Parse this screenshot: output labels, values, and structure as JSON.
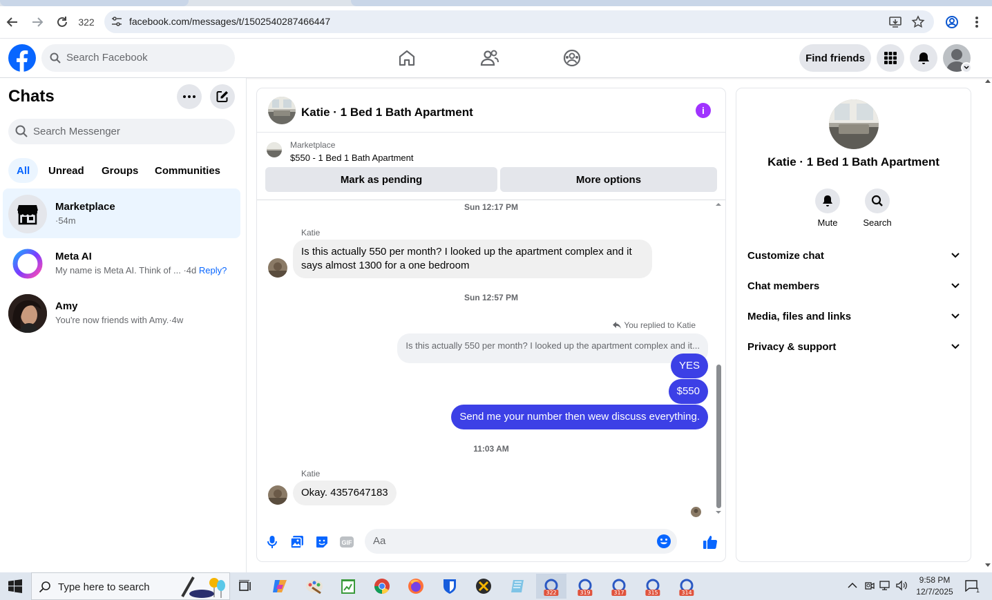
{
  "browser": {
    "tab_count": "322",
    "url": "facebook.com/messages/t/1502540287466447"
  },
  "fb_header": {
    "search_placeholder": "Search Facebook",
    "find_friends": "Find friends"
  },
  "left": {
    "title": "Chats",
    "search_placeholder": "Search Messenger",
    "filters": [
      "All",
      "Unread",
      "Groups",
      "Communities"
    ],
    "chats": [
      {
        "name": "Marketplace",
        "preview": "",
        "meta": "·54m"
      },
      {
        "name": "Meta AI",
        "preview": "My name is Meta AI. Think of ... ",
        "meta": "·4d ",
        "reply": "Reply?"
      },
      {
        "name": "Amy",
        "preview": "You're now friends with Amy.",
        "meta": "·4w"
      }
    ]
  },
  "conversation": {
    "title": "Katie · 1 Bed 1 Bath Apartment",
    "marketplace_label": "Marketplace",
    "listing": "$550 - 1 Bed 1 Bath Apartment",
    "mark_pending": "Mark as pending",
    "more_options": "More options",
    "timestamps": [
      "Sun 12:17 PM",
      "Sun 12:57 PM",
      "11:03 AM"
    ],
    "sender_name": "Katie",
    "msg1": "Is this actually 550 per month? I looked up the apartment complex and it says almost 1300 for a one bedroom",
    "replied_label": "You replied to Katie",
    "quote": "Is this actually 550 per month? I looked up the apartment complex and it...",
    "out1": "YES",
    "out2": "$550",
    "out3": "Send me your number then wew discuss everything.",
    "msg2": "Okay. 4357647183",
    "composer_placeholder": "Aa"
  },
  "details": {
    "title": "Katie · 1 Bed 1 Bath Apartment",
    "mute": "Mute",
    "search": "Search",
    "sections": [
      "Customize chat",
      "Chat members",
      "Media, files and links",
      "Privacy & support"
    ]
  },
  "taskbar": {
    "search_placeholder": "Type here to search",
    "time": "9:58 PM",
    "date": "12/7/2025",
    "badges": [
      "322",
      "319",
      "317",
      "315",
      "314"
    ],
    "notification_count": "1"
  },
  "colors": {
    "fb_blue": "#0866ff",
    "outgoing_bubble": "#3c40e6",
    "info_purple": "#a033ff"
  }
}
